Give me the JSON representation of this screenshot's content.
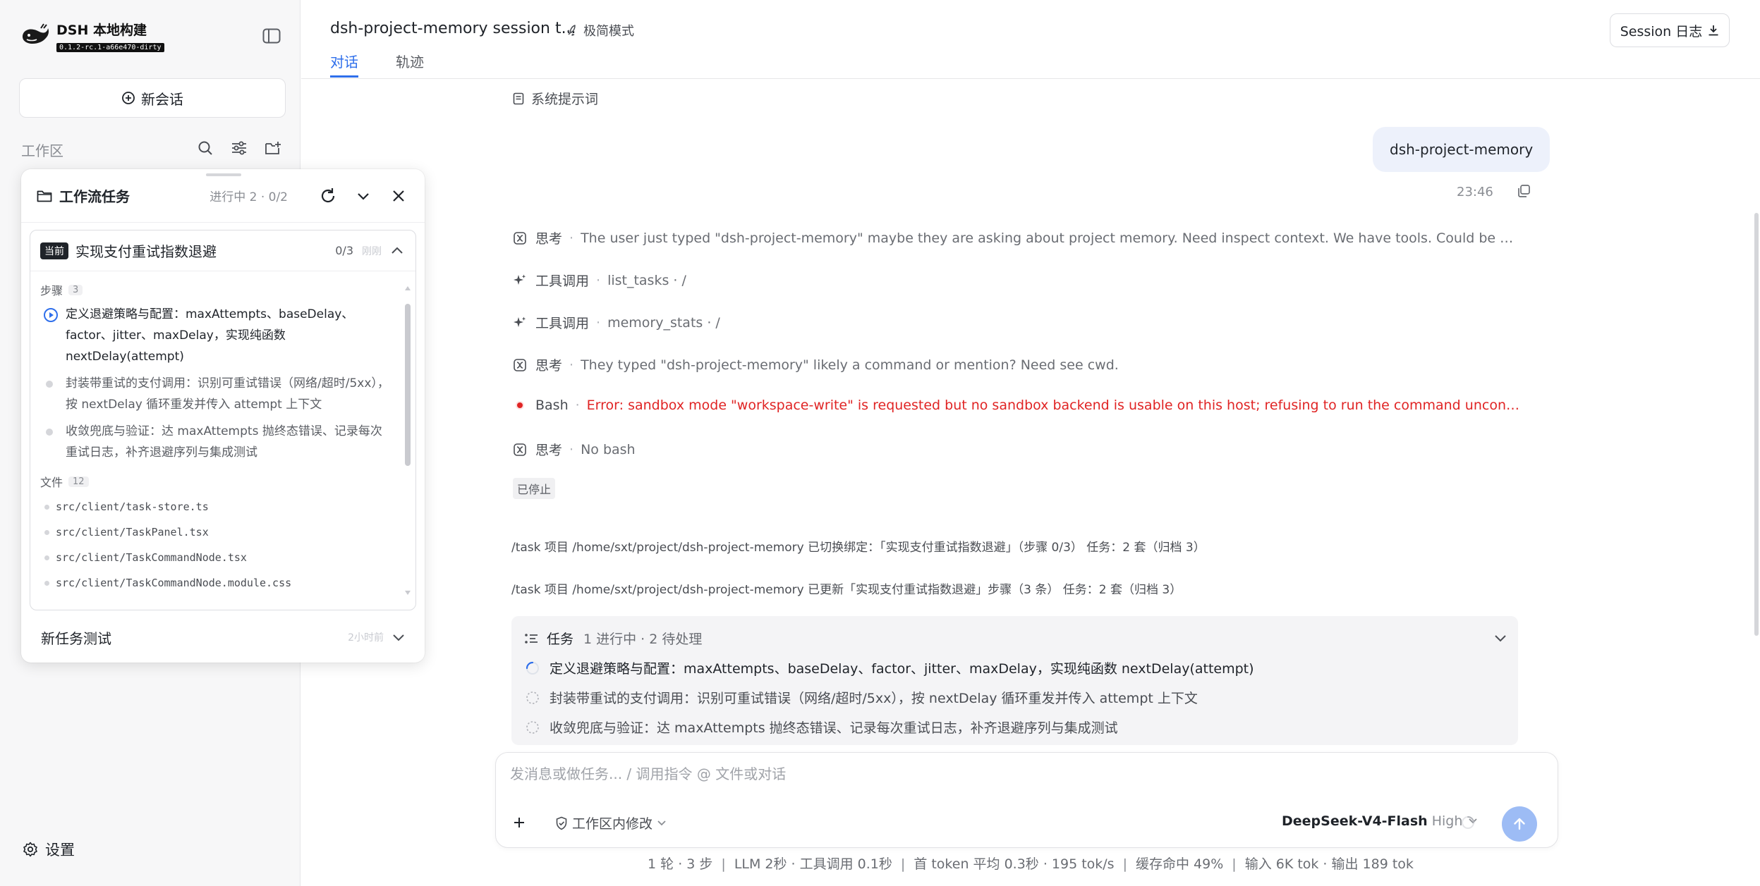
{
  "brand": {
    "name": "DSH 本地构建",
    "version": "0.1.2-rc.1-a66e470-dirty",
    "logo_icon": "whale-logo-icon"
  },
  "sidebar": {
    "new_chat_label": "新会话",
    "workspace_label": "工作区",
    "workspace_icons": [
      "search-icon",
      "filter-icon",
      "new-folder-icon"
    ],
    "settings_label": "设置"
  },
  "task_panel": {
    "title": "工作流任务",
    "progress": "进行中 2 · 0/2",
    "current": {
      "tag": "当前",
      "title": "实现支付重试指数退避",
      "count": "0/3",
      "time": "刚刚",
      "steps_label": "步骤",
      "steps_count": "3",
      "steps": [
        {
          "state": "active",
          "text": "定义退避策略与配置：maxAttempts、baseDelay、factor、jitter、maxDelay，实现纯函数 nextDelay(attempt)"
        },
        {
          "state": "pending",
          "text": "封装带重试的支付调用：识别可重试错误（网络/超时/5xx），按 nextDelay 循环重发并传入 attempt 上下文"
        },
        {
          "state": "pending",
          "text": "收敛兜底与验证：达 maxAttempts 抛终态错误、记录每次重试日志，补齐退避序列与集成测试"
        }
      ],
      "files_label": "文件",
      "files_count": "12",
      "files": [
        "src/client/task-store.ts",
        "src/client/TaskPanel.tsx",
        "src/client/TaskCommandNode.tsx",
        "src/client/TaskCommandNode.module.css"
      ]
    },
    "next": {
      "title": "新任务测试",
      "time": "2小时前"
    }
  },
  "header": {
    "session_title": "dsh-project-memory session t...",
    "speed_mode": "极简模式",
    "tabs": [
      {
        "label": "对话",
        "active": true
      },
      {
        "label": "轨迹",
        "active": false
      }
    ],
    "log_button": "Session 日志"
  },
  "conversation": {
    "system_prompt_label": "系统提示词",
    "user_message": "dsh-project-memory",
    "user_time": "23:46",
    "events": [
      {
        "icon": "thinking-icon",
        "kind": "思考",
        "detail": "The user just typed \"dsh-project-memory\" maybe they are asking about project memory. Need inspect context. We have tools. Could be command? We nee...",
        "error": false
      },
      {
        "icon": "sparkle-icon",
        "kind": "工具调用",
        "detail": "list_tasks · /",
        "error": false
      },
      {
        "icon": "sparkle-icon",
        "kind": "工具调用",
        "detail": "memory_stats · /",
        "error": false
      },
      {
        "icon": "thinking-icon",
        "kind": "思考",
        "detail": "They typed \"dsh-project-memory\" likely a command or mention? Need see cwd.",
        "error": false
      },
      {
        "icon": "error-dot-icon",
        "kind": "Bash",
        "detail": "Error: sandbox mode \"workspace-write\" is requested but no sandbox backend is usable on this host; refusing to run the command unconfined. Install bubble...",
        "error": true
      },
      {
        "icon": "thinking-icon",
        "kind": "思考",
        "detail": "No bash",
        "error": false
      }
    ],
    "stopped_label": "已停止",
    "system_lines": [
      "/task 项目 /home/sxt/project/dsh-project-memory 已切换绑定：「实现支付重试指数退避」（步骤 0/3） 任务：2 套（归档 3）",
      "/task 项目 /home/sxt/project/dsh-project-memory 已更新「实现支付重试指数退避」步骤（3 条） 任务：2 套（归档 3）"
    ],
    "tasks_card": {
      "title": "任务",
      "summary": "1 进行中 · 2 待处理",
      "items": [
        {
          "state": "running",
          "text": "定义退避策略与配置：maxAttempts、baseDelay、factor、jitter、maxDelay，实现纯函数 nextDelay(attempt)"
        },
        {
          "state": "pending",
          "text": "封装带重试的支付调用：识别可重试错误（网络/超时/5xx），按 nextDelay 循环重发并传入 attempt 上下文"
        },
        {
          "state": "pending",
          "text": "收敛兜底与验证：达 maxAttempts 抛终态错误、记录每次重试日志，补齐退避序列与集成测试"
        }
      ]
    }
  },
  "composer": {
    "placeholder": "发消息或做任务... / 调用指令 @ 文件或对话",
    "value": "",
    "mode_label": "工作区内修改",
    "model_name": "DeepSeek-V4-Flash",
    "model_level": "High"
  },
  "stats": [
    "1 轮 · 3 步",
    "LLM 2秒 · 工具调用 0.1秒",
    "首 token 平均 0.3秒 · 195 tok/s",
    "缓存命中 49%",
    "输入 6K tok · 输出 189 tok"
  ],
  "colors": {
    "accent": "#2f6feb",
    "error": "#e02424",
    "send_button": "#9dbcf5",
    "user_bubble": "#edf1fb"
  }
}
